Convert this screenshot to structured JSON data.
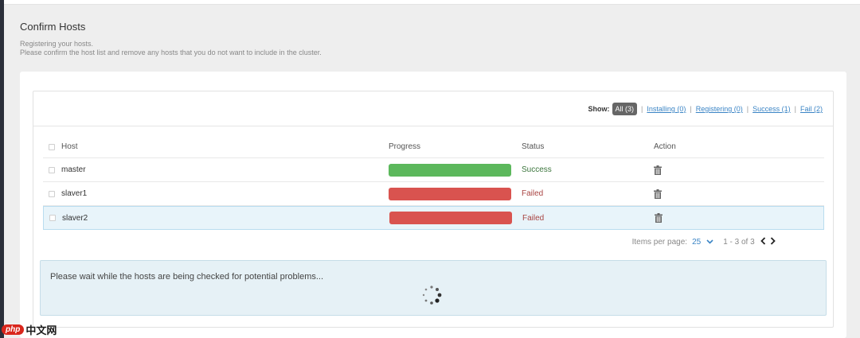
{
  "page": {
    "title": "Confirm Hosts",
    "subtitle_line1": "Registering your hosts.",
    "subtitle_line2": "Please confirm the host list and remove any hosts that you do not want to include in the cluster."
  },
  "filters": {
    "show_label": "Show:",
    "all": "All (3)",
    "installing": "Installing (0)",
    "registering": "Registering (0)",
    "success": "Success (1)",
    "fail": "Fail (2)",
    "separator": "|"
  },
  "table": {
    "headers": {
      "host": "Host",
      "progress": "Progress",
      "status": "Status",
      "action": "Action"
    },
    "rows": [
      {
        "host": "master",
        "progress": 1.0,
        "status": "Success",
        "progress_color": "#5cb85c"
      },
      {
        "host": "slaver1",
        "progress": 1.0,
        "status": "Failed",
        "progress_color": "#d9534f"
      },
      {
        "host": "slaver2",
        "progress": 1.0,
        "status": "Failed",
        "progress_color": "#d9534f"
      }
    ]
  },
  "pagination": {
    "items_per_page_label": "Items per page:",
    "page_size": "25",
    "range": "1 - 3 of 3"
  },
  "wait_message": "Please wait while the hosts are being checked for potential problems...",
  "watermark": {
    "badge": "php",
    "text": "中文网"
  },
  "colors": {
    "accent": "#3a84c5",
    "success": "#5cb85c",
    "failed": "#d9534f"
  }
}
